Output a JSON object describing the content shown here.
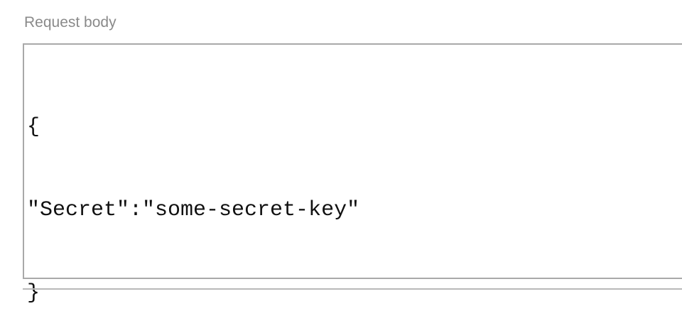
{
  "request_body": {
    "label": "Request body",
    "lines": [
      "{",
      "\"Secret\":\"some-secret-key\"",
      "}"
    ]
  }
}
